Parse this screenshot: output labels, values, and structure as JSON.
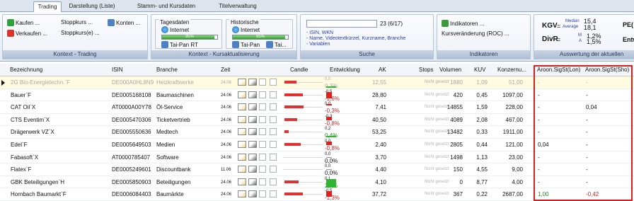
{
  "tabs": [
    "Trading",
    "Darstellung (Liste)",
    "Stamm- und Kursdaten",
    "Titelverwaltung"
  ],
  "ribbon": {
    "trading": {
      "kaufen": "Kaufen ...",
      "verkaufen": "Verkaufen ...",
      "stopp": "Stoppkurs ...",
      "stopps": "Stoppkurs(e) ...",
      "konten": "Konten ...",
      "title": "Kontext - Trading"
    },
    "kurs": {
      "tages": "Tagesdaten",
      "hist": "Historische",
      "internet": "Internet",
      "taipan_rt": "Tai-Pan RT",
      "taipan": "Tai-Pan",
      "tai": "Tai...",
      "progress_pct": "95%",
      "progress_value": 0.95,
      "title": "Kontext - Kursaktualisierung"
    },
    "suche": {
      "count": "23 (6/17)",
      "hint1": "- ISIN, WKN",
      "hint2": "- Name, Videotextkürzel, Kurzname, Branche",
      "hint3": "- Variablen",
      "title": "Suche"
    },
    "indikatoren": {
      "btn": "Indikatoren ...",
      "roc": "Kursveränderung (ROC) ...",
      "title": "Indikatoren"
    },
    "auswertung": {
      "kgv": "KGV",
      "kgv_median": "Median",
      "kgv_median_val": "15,4",
      "kgv_average": "Average",
      "kgv_average_val": "18,1",
      "divr": "DivR",
      "divr_m": "M",
      "divr_m_val": "1,2%",
      "divr_a": "A",
      "divr_a_val": "1,5%",
      "pe": "PE(",
      "entw": "Entw",
      "title": "Auswertung der aktuellen"
    }
  },
  "columns": {
    "name": "Bezeichnung",
    "isin": "ISIN",
    "branche": "Branche",
    "zeit": "Zeit",
    "candle": "Candle",
    "entw": "Entwicklung",
    "ak": "AK",
    "stops": "Stops",
    "volumen": "Volumen",
    "kuv": "KUV",
    "konzern": "Konzernu...",
    "aroon_lon": "Aroon.SigSt(Lon)",
    "aroon_sho": "Aroon.SigSt(Sho)"
  },
  "rows": [
    {
      "name": "2G Bio-Energietechn.`F",
      "isin": "DE000A0HL8N9",
      "branche": "Heizkraftwerke",
      "zeit": "24.06",
      "dev_top": "0,0",
      "dev_bot": "0,3%",
      "ak": "12,55",
      "stops": "Nicht gesetzt",
      "vol": "1880",
      "kuv": "1,09",
      "konz": "51,00",
      "lon": "-",
      "sho": "-",
      "sel": true
    },
    {
      "name": "Bauer`F",
      "isin": "DE0005168108",
      "branche": "Baumaschinen",
      "zeit": "24.06",
      "dev_top": "-0,5",
      "dev_bot": "-1,6%",
      "ak": "28,80",
      "stops": "Nicht gesetzt",
      "vol": "420",
      "kuv": "0,45",
      "konz": "1097,00",
      "lon": "-",
      "sho": "-"
    },
    {
      "name": "CAT Oil`X",
      "isin": "AT0000A00Y78",
      "branche": "Öl-Service",
      "zeit": "24.06",
      "dev_top": "0,0",
      "dev_bot": "-0,3%",
      "ak": "7,41",
      "stops": "Nicht gesetzt",
      "vol": "14855",
      "kuv": "1,59",
      "konz": "228,00",
      "lon": "-",
      "sho": "0,04"
    },
    {
      "name": "CTS Eventim`X",
      "isin": "DE0005470306",
      "branche": "Ticketvertrieb",
      "zeit": "24.06",
      "dev_top": "-0,3",
      "dev_bot": "-0,8%",
      "ak": "40,50",
      "stops": "Nicht gesetzt",
      "vol": "4089",
      "kuv": "2,08",
      "konz": "467,00",
      "lon": "-",
      "sho": "-"
    },
    {
      "name": "Drägerwerk VZ`X",
      "isin": "DE0005550636",
      "branche": "Medtech",
      "zeit": "24.06",
      "dev_top": "0,2",
      "dev_bot": "0,4%",
      "ak": "53,25",
      "stops": "Nicht gesetzt",
      "vol": "13482",
      "kuv": "0,33",
      "konz": "1911,00",
      "lon": "-",
      "sho": "-"
    },
    {
      "name": "Edel`F",
      "isin": "DE0005649503",
      "branche": "Medien",
      "zeit": "24.06",
      "dev_top": "0,0",
      "dev_bot": "-0,8%",
      "ak": "2,40",
      "stops": "Nicht gesetzt",
      "vol": "2805",
      "kuv": "0,44",
      "konz": "121,00",
      "lon": "0,04",
      "sho": "-"
    },
    {
      "name": "Fabasoft`X",
      "isin": "AT0000785407",
      "branche": "Software",
      "zeit": "24.06",
      "dev_top": "0,0",
      "dev_bot": "0,0%",
      "ak": "3,70",
      "stops": "Nicht gesetzt",
      "vol": "1498",
      "kuv": "1,13",
      "konz": "23,00",
      "lon": "-",
      "sho": "-"
    },
    {
      "name": "Flatex`F",
      "isin": "DE0005249601",
      "branche": "Discountbank",
      "zeit": "11.06",
      "dev_top": "0,0",
      "dev_bot": "0,0%",
      "ak": "4,40",
      "stops": "Nicht gesetzt",
      "vol": "150",
      "kuv": "4,55",
      "konz": "9,00",
      "lon": "-",
      "sho": "-"
    },
    {
      "name": "GBK Beteiligungen`H",
      "isin": "DE0005850903",
      "branche": "Beteiligungen",
      "zeit": "24.06",
      "dev_top": "0,1",
      "dev_bot": "2,5%",
      "ak": "4,10",
      "stops": "Nicht gesetzt",
      "vol": "0",
      "kuv": "8,77",
      "konz": "4,00",
      "lon": "-",
      "sho": "-"
    },
    {
      "name": "Hornbach Baumarkt`F",
      "isin": "DE0006084403",
      "branche": "Baumärkte",
      "zeit": "24.06",
      "dev_top": "-0,5",
      "dev_bot": "-1,3%",
      "ak": "37,72",
      "stops": "Nicht gesetzt",
      "vol": "367",
      "kuv": "0,22",
      "konz": "2687,00",
      "lon": "1,00",
      "sho": "-0,42"
    }
  ],
  "row_candles": [
    {
      "body": 0.55,
      "dir": "down"
    },
    {
      "body": 0.85,
      "dir": "down"
    },
    {
      "body": 0.9,
      "dir": "down"
    },
    {
      "body": 0.6,
      "dir": "down"
    },
    {
      "body": 0.2,
      "dir": "down"
    },
    {
      "body": 0.75,
      "dir": "down"
    },
    {
      "body": 0.0,
      "dir": "flat"
    },
    {
      "body": 0.0,
      "dir": "flat"
    },
    {
      "body": 0.65,
      "dir": "down"
    },
    {
      "body": 0.85,
      "dir": "down"
    }
  ],
  "colors": {
    "accent_red": "#d42020",
    "pos_green": "#1f8a1f",
    "neg_red": "#cc2222",
    "bar_green": "#2fb52f"
  }
}
